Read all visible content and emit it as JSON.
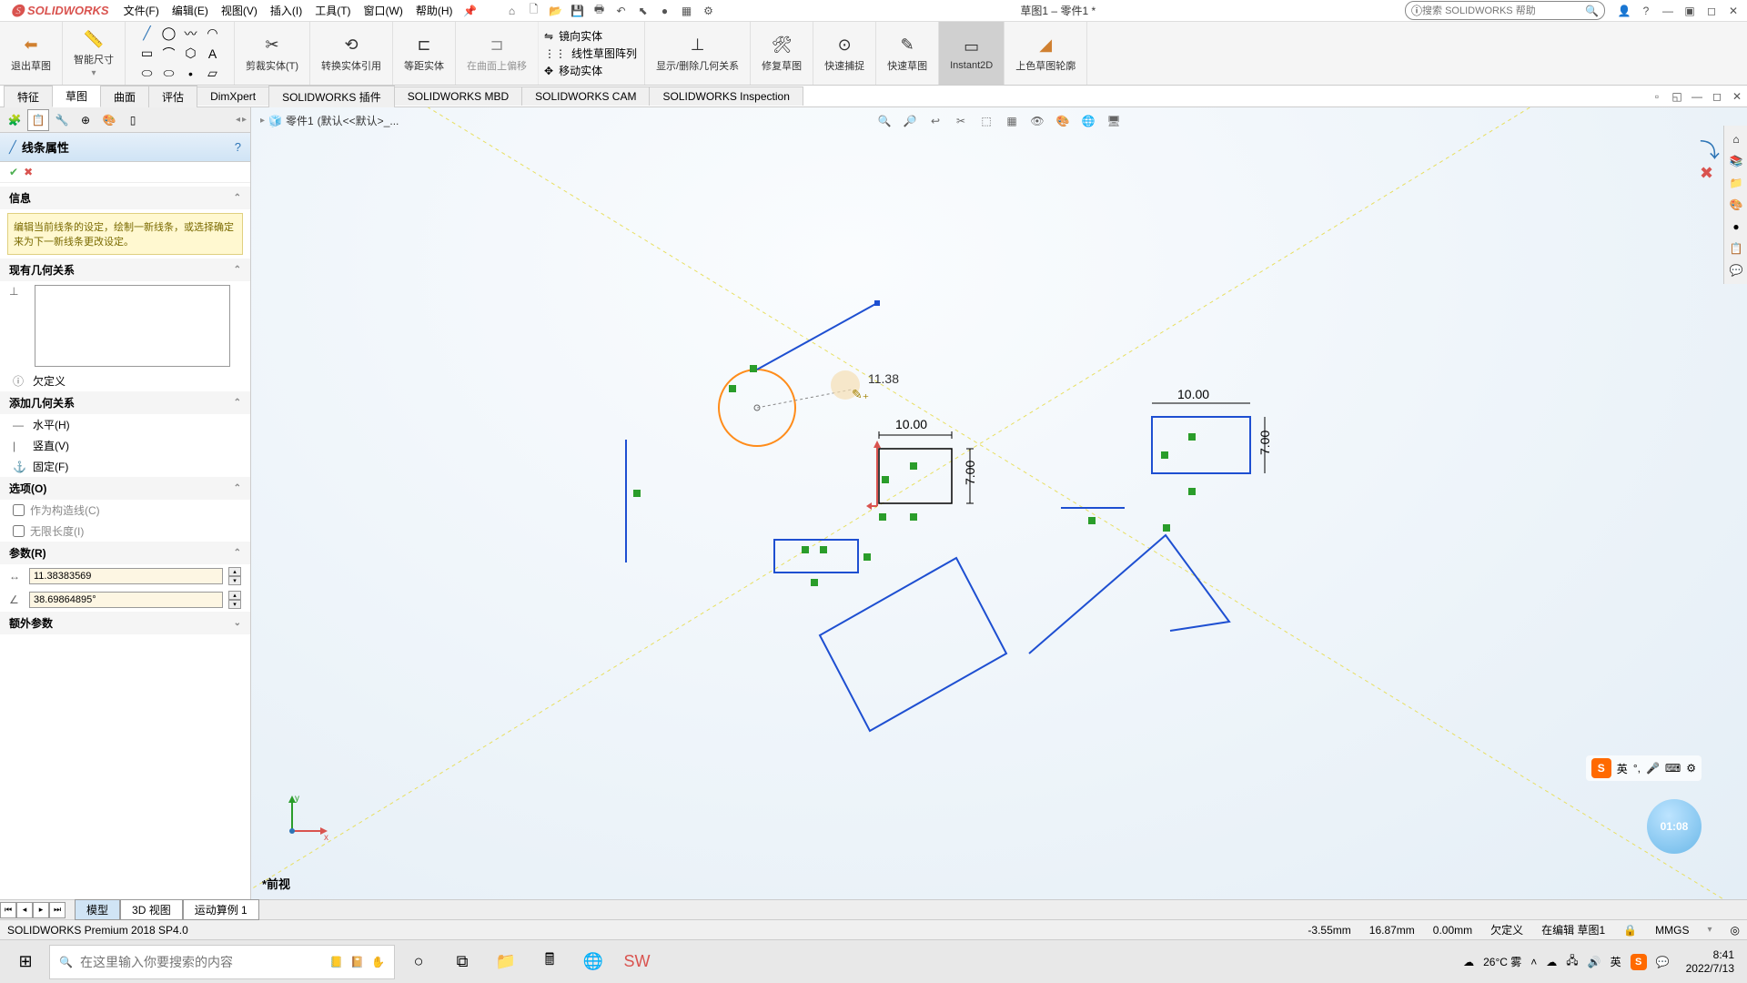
{
  "app": {
    "name": "SOLIDWORKS",
    "doc_title": "草图1 – 零件1 *"
  },
  "menus": [
    "文件(F)",
    "编辑(E)",
    "视图(V)",
    "插入(I)",
    "工具(T)",
    "窗口(W)",
    "帮助(H)"
  ],
  "search_help_placeholder": "搜索 SOLIDWORKS 帮助",
  "ribbon": {
    "exit_sketch": "退出草图",
    "smart_dim": "智能尺寸",
    "trim": "剪裁实体(T)",
    "convert": "转换实体引用",
    "offset": "等距实体",
    "on_surface": "在曲面上偏移",
    "mirror": "镜向实体",
    "linear_pattern": "线性草图阵列",
    "move": "移动实体",
    "display_delete": "显示/删除几何关系",
    "repair": "修复草图",
    "quick_snap": "快速捕捉",
    "quick_sketch": "快速草图",
    "instant2d": "Instant2D",
    "shaded": "上色草图轮廓"
  },
  "cmd_tabs": [
    "特征",
    "草图",
    "曲面",
    "评估",
    "DimXpert",
    "SOLIDWORKS 插件",
    "SOLIDWORKS MBD",
    "SOLIDWORKS CAM",
    "SOLIDWORKS Inspection"
  ],
  "cmd_tab_active": 1,
  "pm": {
    "title": "线条属性",
    "info_title": "信息",
    "info_text": "编辑当前线条的设定，绘制一新线条，或选择确定来为下一新线条更改设定。",
    "existing_title": "现有几何关系",
    "under_defined": "欠定义",
    "add_title": "添加几何关系",
    "horizontal": "水平(H)",
    "vertical": "竖直(V)",
    "fix": "固定(F)",
    "options_title": "选项(O)",
    "construction": "作为构造线(C)",
    "infinite": "无限长度(I)",
    "params_title": "参数(R)",
    "length": "11.38383569",
    "angle": "38.69864895°",
    "extra_params": "额外参数"
  },
  "breadcrumb": {
    "part": "零件1",
    "config": "(默认<<默认>_..."
  },
  "sketch_cursor_value": "11.38",
  "dims": {
    "d1": "10.00",
    "d2": "7.00",
    "d3": "10.00",
    "d4": "7.00"
  },
  "front_view_label": "*前视",
  "view_tabs": [
    "模型",
    "3D 视图",
    "运动算例 1"
  ],
  "status": {
    "version": "SOLIDWORKS Premium 2018 SP4.0",
    "x": "-3.55mm",
    "y": "16.87mm",
    "z": "0.00mm",
    "defined": "欠定义",
    "editing": "在编辑 草图1",
    "units": "MMGS"
  },
  "taskbar": {
    "search_placeholder": "在这里输入你要搜索的内容",
    "weather": "26°C 雾",
    "ime": "英",
    "time": "8:41",
    "date": "2022/7/13"
  },
  "recording_time": "01:08"
}
